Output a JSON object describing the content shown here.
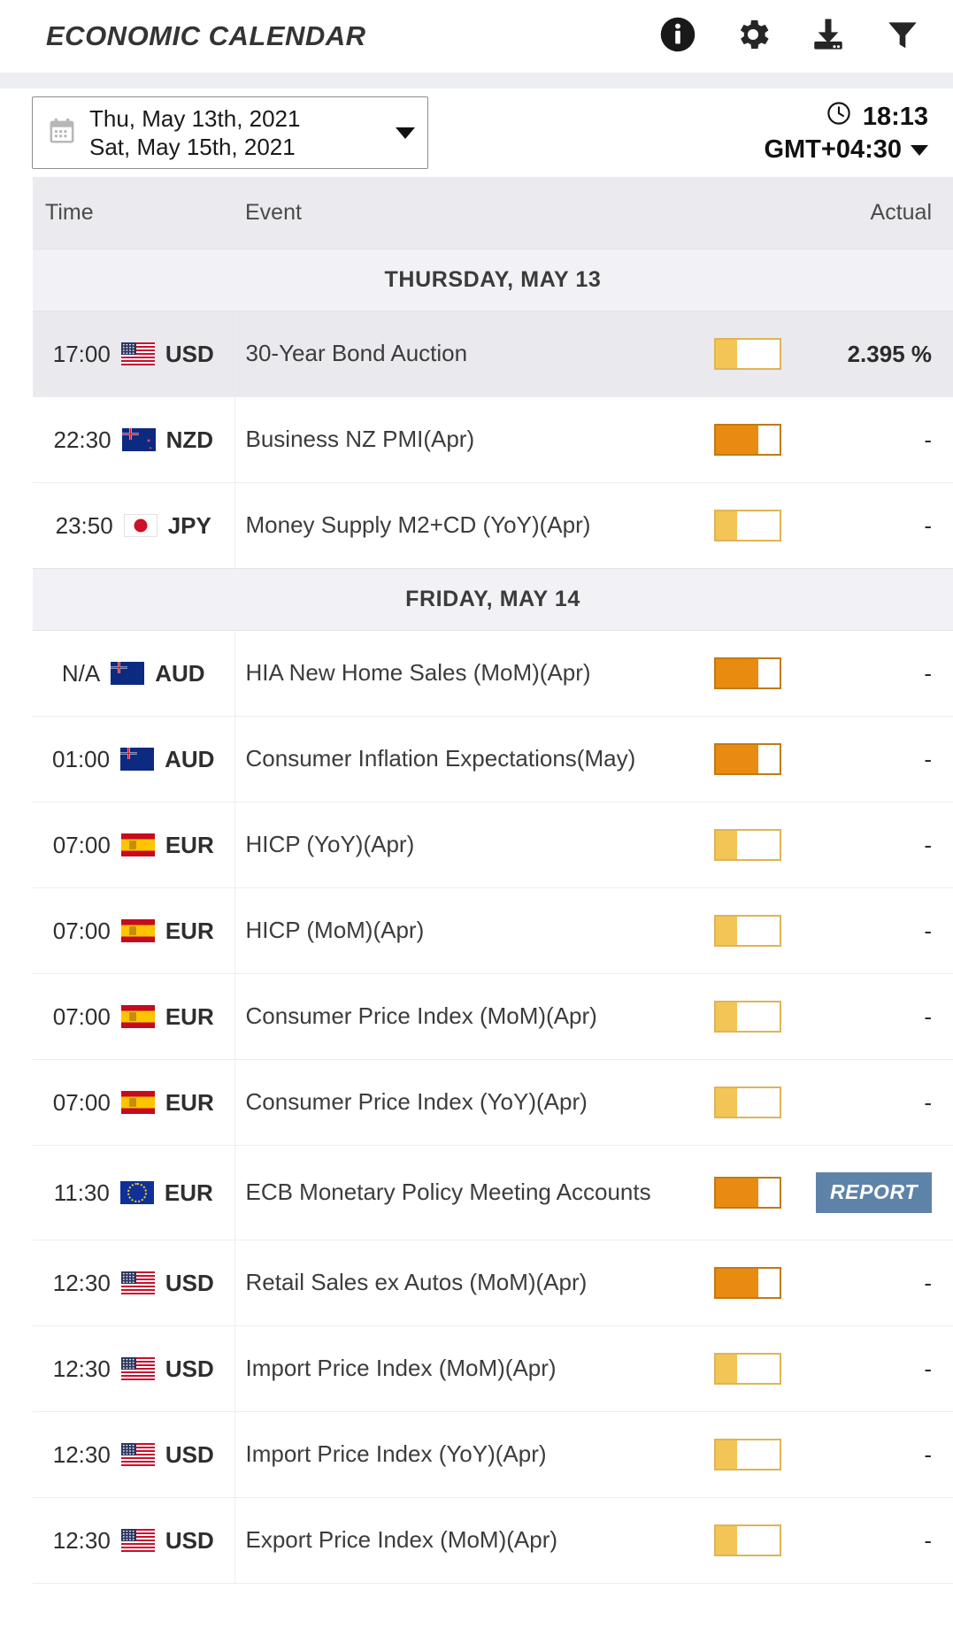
{
  "header": {
    "title": "ECONOMIC CALENDAR",
    "icons": [
      {
        "name": "info-icon",
        "label": "Info"
      },
      {
        "name": "gear-icon",
        "label": "Settings"
      },
      {
        "name": "download-icon",
        "label": "Download"
      },
      {
        "name": "filter-icon",
        "label": "Filter"
      }
    ]
  },
  "controls": {
    "date_range_line1": "Thu, May 13th, 2021",
    "date_range_line2": "Sat, May 15th, 2021",
    "clock_time": "18:13",
    "timezone": "GMT+04:30"
  },
  "table": {
    "columns": {
      "time": "Time",
      "event": "Event",
      "actual": "Actual"
    }
  },
  "colors": {
    "volatility_low": "#f3c556",
    "volatility_medium": "#e98b10",
    "report_badge": "#5e83a8",
    "header_bg": "#ebebef",
    "day_sep_bg": "#f2f2f6",
    "highlight_row_bg": "#e9e9ee"
  },
  "days": [
    {
      "label": "THURSDAY, MAY 13",
      "rows": [
        {
          "time": "17:00",
          "currency": "USD",
          "flag": "us",
          "event": "30-Year Bond Auction",
          "volatility": "low",
          "actual": "2.395 %",
          "actual_type": "value",
          "highlighted": true
        },
        {
          "time": "22:30",
          "currency": "NZD",
          "flag": "nz",
          "event": "Business NZ PMI(Apr)",
          "volatility": "medium",
          "actual": "-",
          "actual_type": "empty",
          "highlighted": false
        },
        {
          "time": "23:50",
          "currency": "JPY",
          "flag": "jp",
          "event": "Money Supply M2+CD (YoY)(Apr)",
          "volatility": "low",
          "actual": "-",
          "actual_type": "empty",
          "highlighted": false
        }
      ]
    },
    {
      "label": "FRIDAY, MAY 14",
      "rows": [
        {
          "time": "N/A",
          "currency": "AUD",
          "flag": "au",
          "event": "HIA New Home Sales (MoM)(Apr)",
          "volatility": "medium",
          "actual": "-",
          "actual_type": "empty",
          "highlighted": false
        },
        {
          "time": "01:00",
          "currency": "AUD",
          "flag": "au",
          "event": "Consumer Inflation Expectations(May)",
          "volatility": "medium",
          "actual": "-",
          "actual_type": "empty",
          "highlighted": false
        },
        {
          "time": "07:00",
          "currency": "EUR",
          "flag": "es",
          "event": "HICP (YoY)(Apr)",
          "volatility": "low",
          "actual": "-",
          "actual_type": "empty",
          "highlighted": false
        },
        {
          "time": "07:00",
          "currency": "EUR",
          "flag": "es",
          "event": "HICP (MoM)(Apr)",
          "volatility": "low",
          "actual": "-",
          "actual_type": "empty",
          "highlighted": false
        },
        {
          "time": "07:00",
          "currency": "EUR",
          "flag": "es",
          "event": "Consumer Price Index (MoM)(Apr)",
          "volatility": "low",
          "actual": "-",
          "actual_type": "empty",
          "highlighted": false
        },
        {
          "time": "07:00",
          "currency": "EUR",
          "flag": "es",
          "event": "Consumer Price Index (YoY)(Apr)",
          "volatility": "low",
          "actual": "-",
          "actual_type": "empty",
          "highlighted": false
        },
        {
          "time": "11:30",
          "currency": "EUR",
          "flag": "eu",
          "event": "ECB Monetary Policy Meeting Accounts",
          "volatility": "medium",
          "actual": "REPORT",
          "actual_type": "report",
          "highlighted": false
        },
        {
          "time": "12:30",
          "currency": "USD",
          "flag": "us",
          "event": "Retail Sales ex Autos (MoM)(Apr)",
          "volatility": "medium",
          "actual": "-",
          "actual_type": "empty",
          "highlighted": false
        },
        {
          "time": "12:30",
          "currency": "USD",
          "flag": "us",
          "event": "Import Price Index (MoM)(Apr)",
          "volatility": "low",
          "actual": "-",
          "actual_type": "empty",
          "highlighted": false
        },
        {
          "time": "12:30",
          "currency": "USD",
          "flag": "us",
          "event": "Import Price Index (YoY)(Apr)",
          "volatility": "low",
          "actual": "-",
          "actual_type": "empty",
          "highlighted": false
        },
        {
          "time": "12:30",
          "currency": "USD",
          "flag": "us",
          "event": "Export Price Index (MoM)(Apr)",
          "volatility": "low",
          "actual": "-",
          "actual_type": "empty",
          "highlighted": false
        }
      ]
    }
  ]
}
